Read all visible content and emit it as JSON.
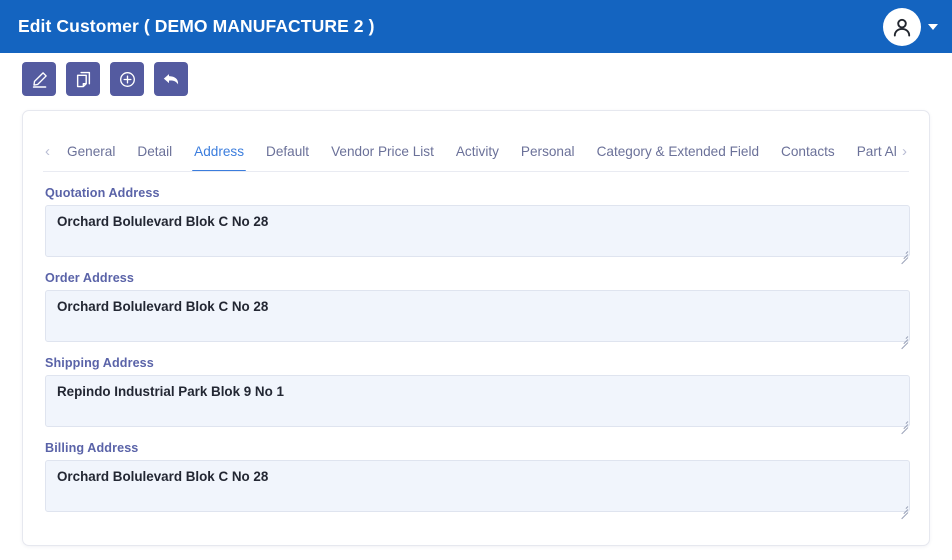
{
  "header": {
    "title": "Edit Customer ( DEMO MANUFACTURE 2 )",
    "background_color": "#1464c0",
    "avatar_icon": "user-icon",
    "caret_icon": "chevron-down-icon"
  },
  "toolbar": {
    "background_color": "#545ba0",
    "buttons": [
      {
        "name": "edit-button",
        "icon": "pencil-edit-icon",
        "label": "Edit"
      },
      {
        "name": "duplicate-button",
        "icon": "copy-icon",
        "label": "Duplicate"
      },
      {
        "name": "add-button",
        "icon": "plus-circle-icon",
        "label": "Add"
      },
      {
        "name": "back-button",
        "icon": "back-arrow-icon",
        "label": "Back"
      }
    ]
  },
  "tabs": {
    "scroll_left_icon": "chevron-left-icon",
    "scroll_right_icon": "chevron-right-icon",
    "active": "Address",
    "active_color": "#3b7ddd",
    "items": [
      {
        "label": "General",
        "active": false
      },
      {
        "label": "Detail",
        "active": false
      },
      {
        "label": "Address",
        "active": true
      },
      {
        "label": "Default",
        "active": false
      },
      {
        "label": "Vendor Price List",
        "active": false
      },
      {
        "label": "Activity",
        "active": false
      },
      {
        "label": "Personal",
        "active": false
      },
      {
        "label": "Category & Extended Field",
        "active": false
      },
      {
        "label": "Contacts",
        "active": false
      },
      {
        "label": "Part Alia",
        "active": false
      }
    ]
  },
  "form": {
    "fields": [
      {
        "name": "quotation-address",
        "label": "Quotation Address",
        "value": "Orchard Bolulevard Blok C No 28",
        "placeholder": ""
      },
      {
        "name": "order-address",
        "label": "Order Address",
        "value": "Orchard Bolulevard Blok C No 28",
        "placeholder": ""
      },
      {
        "name": "shipping-address",
        "label": "Shipping Address",
        "value": "Repindo Industrial Park Blok 9 No 1",
        "placeholder": ""
      },
      {
        "name": "billing-address",
        "label": "Billing Address",
        "value": "Orchard Bolulevard Blok C No 28",
        "placeholder": ""
      }
    ]
  }
}
